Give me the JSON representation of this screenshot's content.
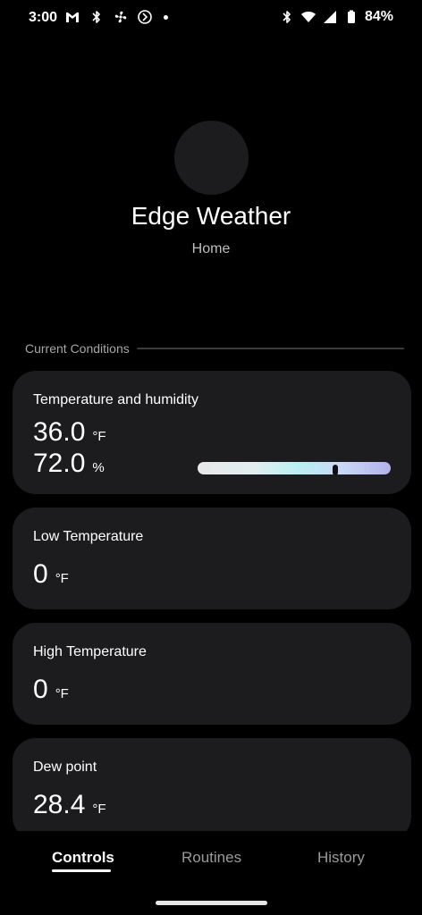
{
  "status_bar": {
    "time": "3:00",
    "battery_percent": "84%",
    "left_icons": [
      "gmail-icon",
      "bluetooth-icon",
      "fan-icon",
      "smartthings-icon",
      "notification-dot-icon"
    ],
    "right_icons": [
      "bluetooth-icon",
      "wifi-icon",
      "cell-signal-icon",
      "battery-icon"
    ]
  },
  "device": {
    "name": "Edge Weather",
    "room": "Home"
  },
  "section": {
    "label": "Current Conditions"
  },
  "cards": {
    "temp_humidity": {
      "title": "Temperature and humidity",
      "temperature": "36.0",
      "temperature_unit": "°F",
      "humidity": "72.0",
      "humidity_unit": "%",
      "humidity_level_percent": 72
    },
    "low_temp": {
      "title": "Low Temperature",
      "value": "0",
      "unit": "°F"
    },
    "high_temp": {
      "title": "High Temperature",
      "value": "0",
      "unit": "°F"
    },
    "dew_point": {
      "title": "Dew point",
      "value": "28.4",
      "unit": "°F"
    }
  },
  "nav": {
    "tabs": [
      {
        "label": "Controls",
        "active": true
      },
      {
        "label": "Routines",
        "active": false
      },
      {
        "label": "History",
        "active": false
      }
    ]
  },
  "colors": {
    "background": "#000000",
    "card": "#1c1c1e",
    "muted_text": "#a6a6a6"
  }
}
